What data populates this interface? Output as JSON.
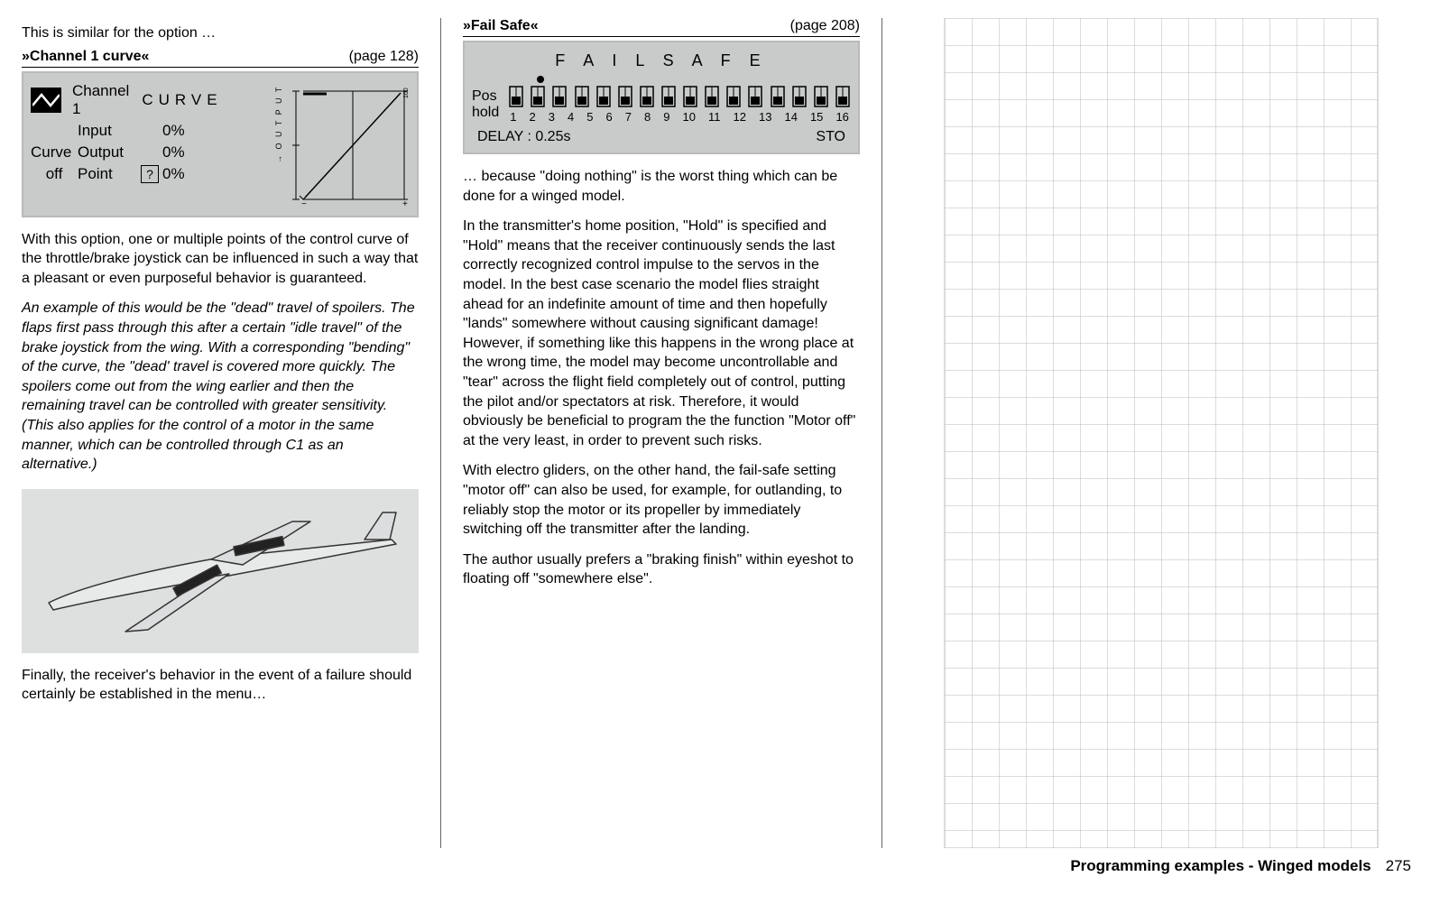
{
  "col1": {
    "intro": "This is similar for the option …",
    "section_title": "»Channel 1 curve«",
    "section_pageref": "(page 128)",
    "panel": {
      "channel_name": "Channel 1",
      "curve_word": "CURVE",
      "rows": {
        "curve_label": "Curve",
        "off_label": "off",
        "input_label": "Input",
        "output_label": "Output",
        "point_label": "Point",
        "q_mark": "?",
        "input_val": "0%",
        "output_val": "0%",
        "point_val": "0%"
      },
      "axis_label": "O U T P U T",
      "axis_max": "100"
    },
    "para1": "With this option, one or multiple points of the control curve of the throttle/brake joystick can be influenced in such a way that a pleasant or even purposeful behavior is guaranteed.",
    "para2_italic": "An example of this would be the \"dead\" travel of spoilers. The flaps first pass through this after a certain \"idle travel\" of the brake joystick from the wing. With a corresponding \"bending\" of the curve, the \"dead' travel is covered more quickly. The spoilers come out from the wing earlier and then the remaining travel can be controlled with greater sensitivity. (This also applies for the control of a motor in the same manner, which can be controlled through C1 as an alternative.)",
    "para3": "Finally, the receiver's behavior in the event of a failure should certainly be established in the menu…"
  },
  "col2": {
    "section_title": "»Fail Safe«",
    "section_pageref": "(page 208)",
    "panel": {
      "title": "F A I L     S A F E",
      "left_top": "Pos",
      "left_bot": "hold",
      "numbers": [
        "1",
        "2",
        "3",
        "4",
        "5",
        "6",
        "7",
        "8",
        "9",
        "10",
        "11",
        "12",
        "13",
        "14",
        "15",
        "16"
      ],
      "delay": "DELAY : 0.25s",
      "sto": "STO"
    },
    "para1": "… because \"doing nothing\" is the worst thing which can be done for a winged model.",
    "para2": "In the transmitter's home position, \"Hold\" is specified and \"Hold\" means that the receiver continuously sends the last correctly recognized control impulse to the servos in the model. In the best case scenario the model flies straight ahead for an indefinite amount of time and then hopefully \"lands\" somewhere without causing significant damage! However, if something like this happens in the wrong place at the wrong time, the model may become uncontrollable and \"tear\" across the flight field completely out of control, putting the pilot and/or spectators at risk. Therefore, it would obviously be beneficial to program the the function \"Motor off\" at the very least, in order to prevent such risks.",
    "para3": "With electro gliders, on the other hand, the fail-safe setting \"motor off\" can also be used, for example, for outlanding, to reliably stop the motor or its propeller by immediately switching off the transmitter after the landing.",
    "para4": "The author usually prefers a \"braking finish\" within eyeshot to floating off \"somewhere else\"."
  },
  "footer": {
    "label": "Programming examples - Winged models",
    "page": "275"
  }
}
